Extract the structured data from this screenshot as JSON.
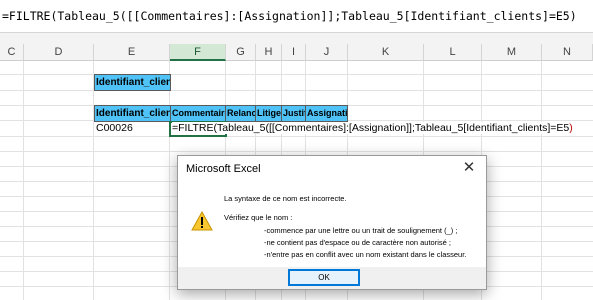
{
  "formula_bar": {
    "formula": "=FILTRE(Tableau_5([[Commentaires]:[Assignation]];Tableau_5[Identifiant_clients]=E5)"
  },
  "columns": [
    {
      "label": "C",
      "selected": false
    },
    {
      "label": "D",
      "selected": false
    },
    {
      "label": "E",
      "selected": false
    },
    {
      "label": "F",
      "selected": true
    },
    {
      "label": "G",
      "selected": false
    },
    {
      "label": "H",
      "selected": false
    },
    {
      "label": "I",
      "selected": false
    },
    {
      "label": "J",
      "selected": false
    },
    {
      "label": "K",
      "selected": false
    },
    {
      "label": "L",
      "selected": false
    },
    {
      "label": "M",
      "selected": false
    },
    {
      "label": "N",
      "selected": false
    }
  ],
  "sheet": {
    "lookup_header": "Identifiant_clients",
    "table_headers": [
      "Identifiant_clients",
      "Commentaires",
      "Relance",
      "Litiges",
      "Justif",
      "Assignation"
    ],
    "client_id": "C00026",
    "active_cell_text": {
      "black_part": "=FILTRE(Tableau_5([[Commentaires]:[Assignation]];Tableau_5[Identifiant_clients]=E5",
      "red_part": ")"
    },
    "header_color": "#4fc3f7"
  },
  "dialog": {
    "title": "Microsoft Excel",
    "close_icon": "close-icon",
    "warning_icon": "warning-icon",
    "message_main": "La syntaxe de ce nom est incorrecte.",
    "message_check": "Vérifiez que le nom :",
    "bullets": [
      "-commence par une lettre ou un trait de soulignement (_) ;",
      "-ne contient pas d'espace ou de caractère non autorisé ;",
      "-n'entre pas en conflit avec un nom existant dans le classeur."
    ],
    "ok_label": "OK"
  }
}
